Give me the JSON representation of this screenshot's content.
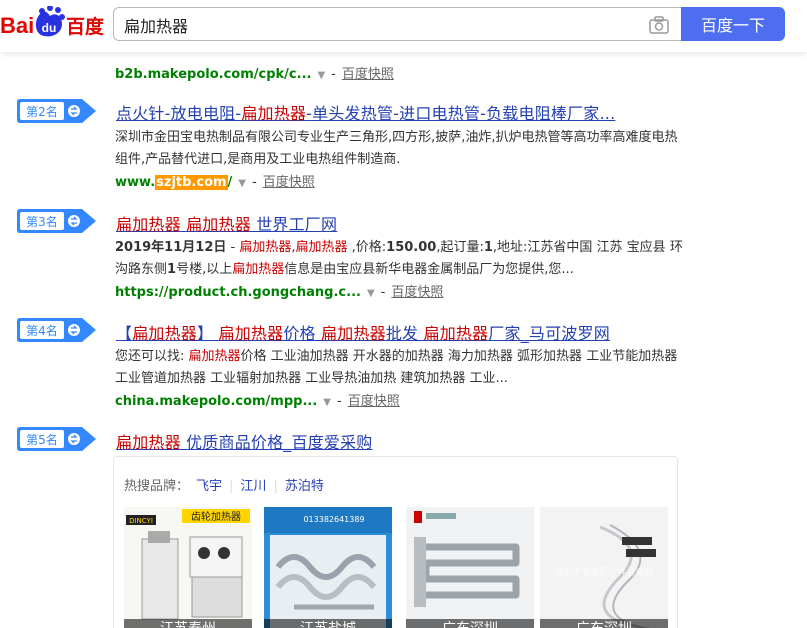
{
  "header": {
    "logo_text_left": "Bai",
    "logo_text_mid": "du",
    "logo_text_right": "百度",
    "search_value": "扁加热器",
    "search_button": "百度一下"
  },
  "partial_top_line": "...................................................................",
  "results": [
    {
      "url_display": "b2b.makepolo.com/cpk/c...",
      "kuaizhao": "百度快照"
    },
    {
      "rank": "第2名",
      "title_parts": [
        "点火针-放电电阻-",
        "扁加热器",
        "-单头发热管-进口电热管-负载电阻棒厂家..."
      ],
      "snippet": "深圳市金田宝电热制品有限公司专业生产三角形,四方形,披萨,油炸,扒炉电热管等高功率高难度电热组件,产品替代进口,是商用及工业电热组件制造商.",
      "url_prefix": "www.",
      "url_mark": "szjtb.com",
      "url_suffix": "/",
      "kuaizhao": "百度快照"
    },
    {
      "rank": "第3名",
      "title_parts": [
        "扁加热器",
        " ",
        "扁加热器",
        " 世界工厂网"
      ],
      "snippet_date": "2019年11月12日",
      "snippet_dash": " - ",
      "snippet_kw1": "扁加热器",
      "snippet_comma": ",",
      "snippet_kw2": "扁加热器",
      "snippet_rest1": " ,价格:",
      "snippet_price": "150.00",
      "snippet_rest2": ",起订量:",
      "snippet_qty": "1",
      "snippet_rest3": ",地址:江苏省中国 江苏 宝应县 环沟路东侧",
      "snippet_no": "1",
      "snippet_rest4": "号楼,以上",
      "snippet_kw3": "扁加热器",
      "snippet_rest5": "信息是由宝应县新华电器金属制品厂为您提供,您...",
      "url_display": "https://product.ch.gongchang.c...",
      "kuaizhao": "百度快照"
    },
    {
      "rank": "第4名",
      "title_parts": [
        "【",
        "扁加热器",
        "】 ",
        "扁加热器",
        "价格 ",
        "扁加热器",
        "批发 ",
        "扁加热器",
        "厂家_马可波罗网"
      ],
      "snippet_lead": "您还可以找: ",
      "snippet_kw1": "扁加热器",
      "snippet_rest": "价格 工业油加热器 开水器的加热器 海力加热器 弧形加热器 工业节能加热器 工业管道加热器 工业辐射加热器 工业导热油加热 建筑加热器 工业...",
      "url_display": "china.makepolo.com/mpp...",
      "kuaizhao": "百度快照"
    },
    {
      "rank": "第5名",
      "title_parts": [
        "扁加热器",
        " 优质商品价格_百度爱采购"
      ]
    }
  ],
  "card": {
    "label": "热搜品牌：",
    "brands": [
      "飞宇",
      "江川",
      "苏泊特"
    ],
    "thumbs": [
      {
        "caption": "江苏泰州",
        "tag1": "DINCYI",
        "tag2": "齿轮加热器"
      },
      {
        "caption": "江苏盐城",
        "tag1": "013382641389"
      },
      {
        "caption": "广东深圳"
      },
      {
        "caption": "广东深圳",
        "tag1": "深圳市宝安区沙井县电器"
      }
    ]
  },
  "colors": {
    "link": "#2440b3",
    "highlight": "#cc0000",
    "url_green": "#008000",
    "button_blue": "#4e6ef2",
    "badge_blue": "#3388ff"
  }
}
